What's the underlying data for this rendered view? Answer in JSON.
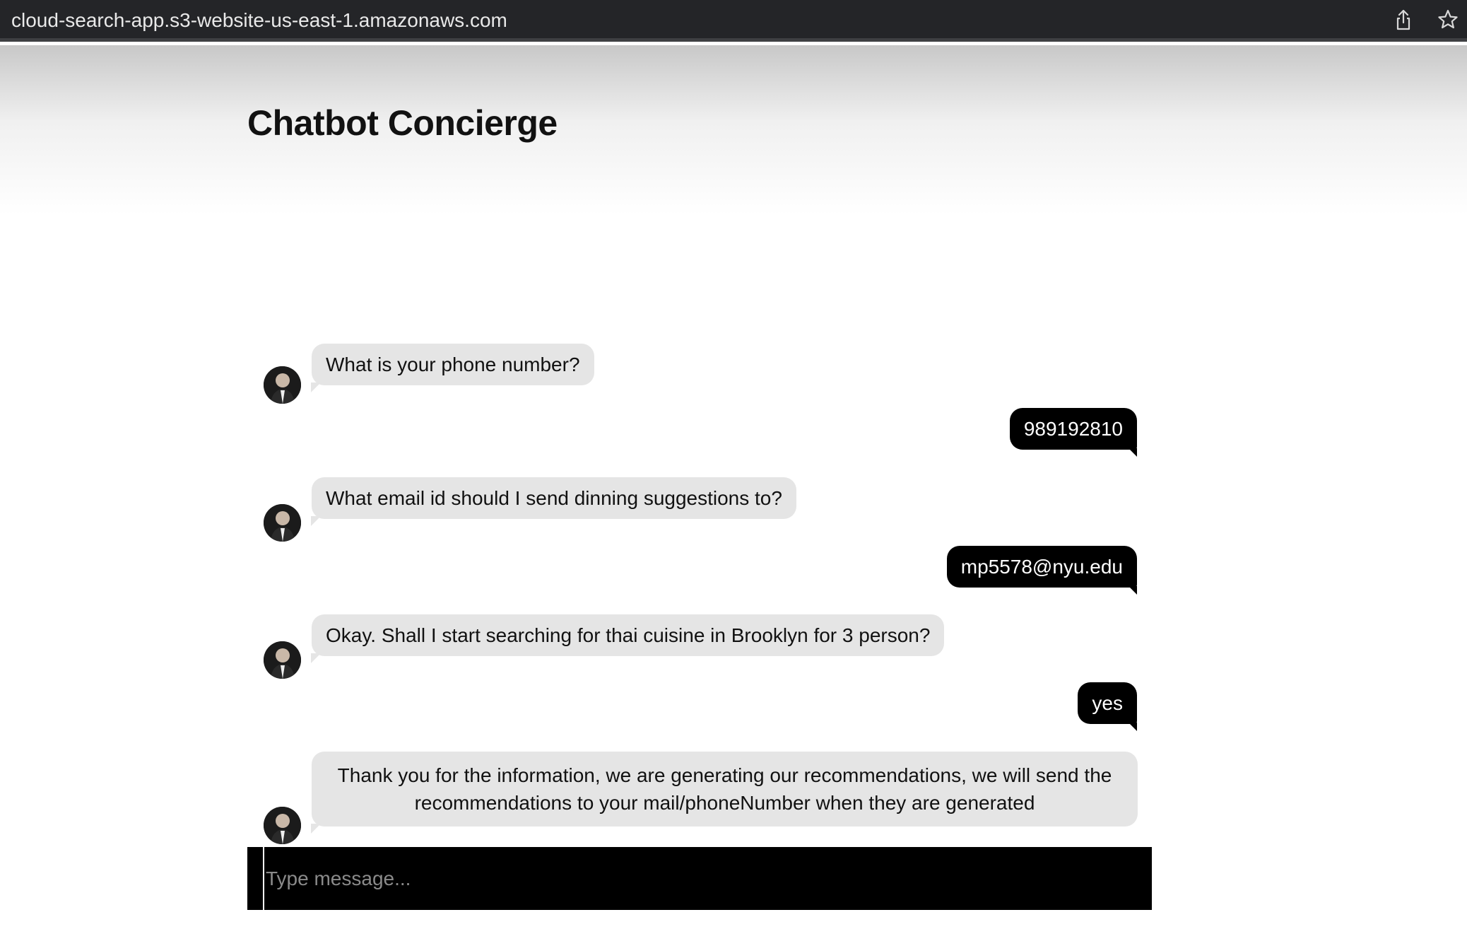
{
  "browser": {
    "url": "cloud-search-app.s3-website-us-east-1.amazonaws.com",
    "share_icon": "share-icon",
    "bookmark_icon": "star-icon"
  },
  "page": {
    "title": "Chatbot Concierge"
  },
  "messages": [
    {
      "sender": "bot",
      "text": "What is your phone number?"
    },
    {
      "sender": "user",
      "text": "989192810"
    },
    {
      "sender": "bot",
      "text": "What email id should I send dinning suggestions to?"
    },
    {
      "sender": "user",
      "text": "mp5578@nyu.edu"
    },
    {
      "sender": "bot",
      "text": "Okay. Shall I start searching for thai cuisine in Brooklyn for 3 person?"
    },
    {
      "sender": "user",
      "text": "yes"
    },
    {
      "sender": "bot",
      "text": "Thank you for the information, we are generating our recommendations, we will send the recommendations to your mail/phoneNumber when they are generated"
    }
  ],
  "composer": {
    "placeholder": "Type message...",
    "value": ""
  },
  "colors": {
    "bot_bubble": "#e5e5e5",
    "user_bubble": "#000000",
    "composer_bg": "#000000",
    "browser_bar": "#242528"
  }
}
